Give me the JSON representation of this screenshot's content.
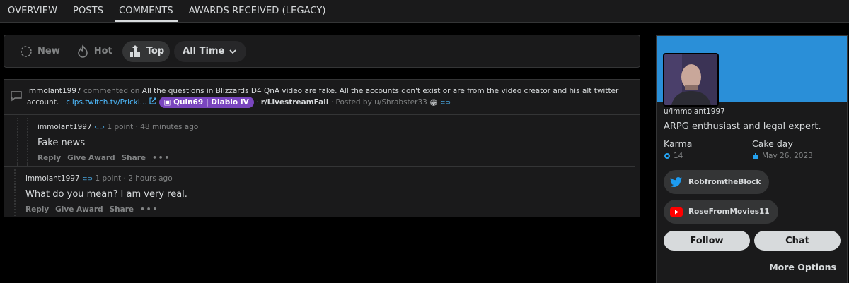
{
  "tabs": [
    "OVERVIEW",
    "POSTS",
    "COMMENTS",
    "AWARDS RECEIVED (LEGACY)"
  ],
  "sort": {
    "new": "New",
    "hot": "Hot",
    "top": "Top",
    "time": "All Time"
  },
  "post": {
    "author": "immolant1997",
    "commented_on": "commented on",
    "title_line1": "All the questions in Blizzards D4 QnA video are fake. All the accounts don't exist or are from the video creator and his alt twitter",
    "title_line2": "account.",
    "link": "clips.twitch.tv/Prickl...",
    "flair": "Quin69 | Diablo IV",
    "subreddit": "r/LivestreamFail",
    "posted_by": "· Posted by u/Shrabster33"
  },
  "comments": [
    {
      "author": "immolant1997",
      "meta": "1 point · 48 minutes ago",
      "body": "Fake news"
    },
    {
      "author": "immolant1997",
      "meta": "1 point · 2 hours ago",
      "body": "What do you mean? I am very real."
    }
  ],
  "actions": {
    "reply": "Reply",
    "award": "Give Award",
    "share": "Share",
    "more": "•••"
  },
  "profile": {
    "username": "u/immolant1997",
    "bio": "ARPG enthusiast and legal expert.",
    "karma_label": "Karma",
    "karma_value": "14",
    "cake_label": "Cake day",
    "cake_value": "May 26, 2023",
    "twitter": "RobfromtheBlock",
    "youtube": "RoseFromMovies11",
    "follow": "Follow",
    "chat": "Chat",
    "more_options": "More Options"
  },
  "colors": {
    "accent": "#2a8fd8",
    "flair": "#7a46bf",
    "link": "#4fbcff"
  }
}
